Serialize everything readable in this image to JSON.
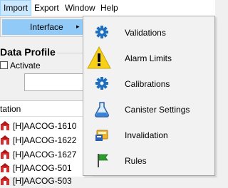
{
  "menubar": {
    "items": [
      {
        "label": "Import"
      },
      {
        "label": "Export"
      },
      {
        "label": "Window"
      },
      {
        "label": "Help"
      }
    ]
  },
  "submenu": {
    "item_label": "Interface",
    "arrow": "▸"
  },
  "section": {
    "title": "Data Profile",
    "checkbox_label": "Activate",
    "textbox_value": ""
  },
  "list": {
    "header": "tation",
    "rows": [
      {
        "text": "[H]AACOG-1610"
      },
      {
        "text": "[H]AACOG-1622"
      },
      {
        "text": "[H]AACOG-1627"
      },
      {
        "text": "[H]AACOG-501"
      },
      {
        "text": "[H]AACOG-503"
      }
    ]
  },
  "dropdown": {
    "items": [
      {
        "label": "Validations",
        "icon": "gear-icon"
      },
      {
        "label": "Alarm Limits",
        "icon": "warning-icon"
      },
      {
        "label": "Calibrations",
        "icon": "gear-icon"
      },
      {
        "label": "Canister Settings",
        "icon": "flask-icon"
      },
      {
        "label": "Invalidation",
        "icon": "invalidation-icon"
      },
      {
        "label": "Rules",
        "icon": "flag-icon"
      }
    ]
  },
  "colors": {
    "accent_highlight": "#91c9f7",
    "menubar_active": "#cce8ff",
    "gear_blue": "#1f6fc0",
    "warning_yellow": "#f7d117",
    "flag_green": "#2e9b2e"
  }
}
